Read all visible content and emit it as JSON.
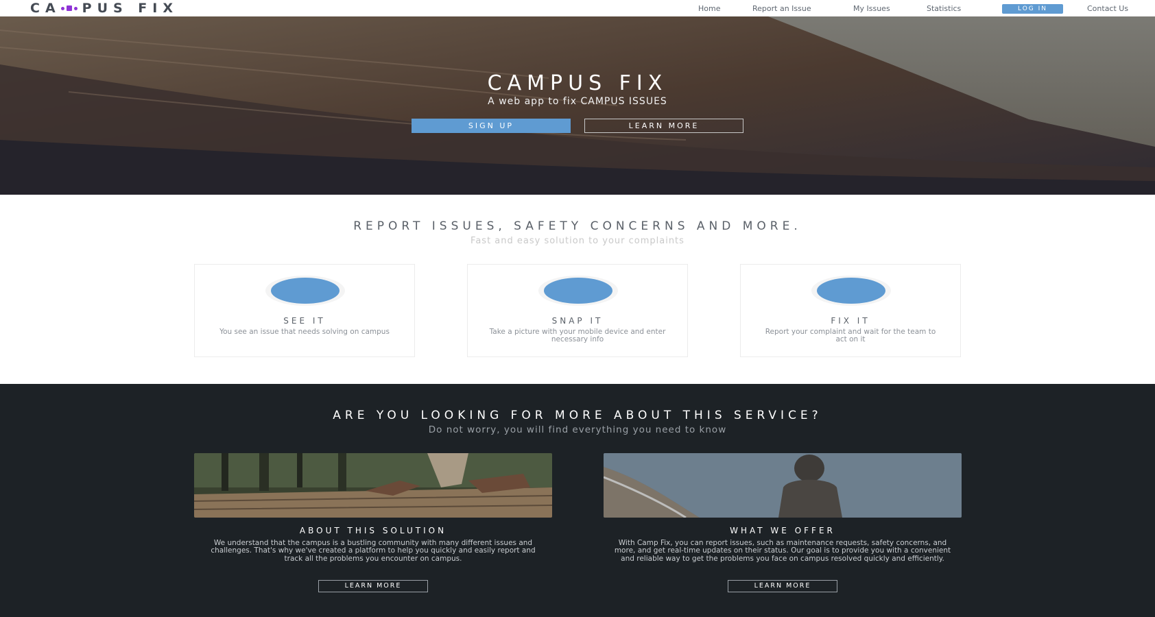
{
  "nav": {
    "logo_prefix": "CA",
    "logo_suffix": "PUS FIX",
    "links": [
      "Home",
      "Report an Issue",
      "My Issues",
      "Statistics"
    ],
    "login_label": "LOG IN",
    "contact_label": "Contact Us"
  },
  "hero": {
    "title": "CAMPUS FIX",
    "subtitle": "A web app to fix CAMPUS ISSUES",
    "signup_label": "SIGN UP",
    "learn_more_label": "LEARN MORE"
  },
  "features": {
    "title": "REPORT ISSUES, SAFETY CONCERNS AND MORE.",
    "subtitle": "Fast and easy solution to your complaints",
    "cards": [
      {
        "title": "SEE IT",
        "desc": "You see an issue that needs solving on campus"
      },
      {
        "title": "SNAP IT",
        "desc": "Take a picture with your mobile device and enter necessary info"
      },
      {
        "title": "FIX IT",
        "desc": "Report your complaint and wait for the team to act on it"
      }
    ]
  },
  "info": {
    "title": "ARE YOU LOOKING FOR MORE ABOUT THIS SERVICE?",
    "subtitle": "Do not worry, you will find everything you need to know",
    "columns": [
      {
        "title": "ABOUT THIS SOLUTION",
        "desc": "We understand that the campus is a bustling community with many different issues and challenges. That's why we've created a platform to help you quickly and easily report and track all the problems you encounter on campus.",
        "button": "LEARN MORE"
      },
      {
        "title": "WHAT WE OFFER",
        "desc": "With Camp Fix, you can report issues, such as maintenance requests, safety concerns, and more, and get real-time updates on their status. Our goal is to provide you with a convenient and reliable way to get the problems you face on campus resolved quickly and efficiently.",
        "button": "LEARN MORE"
      }
    ]
  },
  "colors": {
    "accent": "#5f9bd2",
    "logo_mark": "#8f33d6",
    "dark_bg": "#1d2226"
  }
}
